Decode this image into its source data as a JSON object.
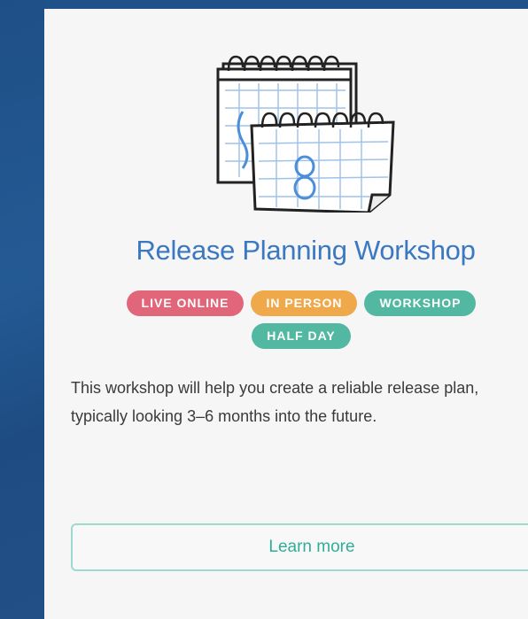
{
  "card": {
    "title": "Release Planning Workshop",
    "tags": [
      {
        "label": "LIVE ONLINE",
        "color": "#e2667a"
      },
      {
        "label": "IN PERSON",
        "color": "#f0a94a"
      },
      {
        "label": "WORKSHOP",
        "color": "#52b8a2"
      },
      {
        "label": "HALF DAY",
        "color": "#52b8a2"
      }
    ],
    "description": "This workshop will help you create a reliable release plan, typically looking 3–6 months into the future.",
    "button_label": "Learn more",
    "illustration_icon": "calendar-icon"
  },
  "colors": {
    "background": "#20528a",
    "card": "#f6f6f6",
    "title": "#3b78c2",
    "button_text": "#2fae98",
    "button_border": "#9fd8cc"
  }
}
